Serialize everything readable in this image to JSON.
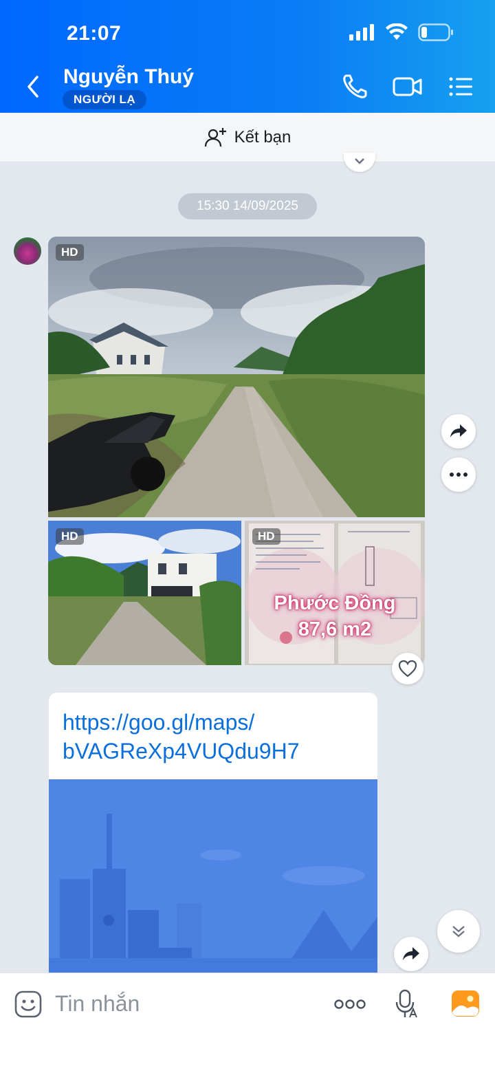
{
  "status": {
    "time": "21:07",
    "icons": [
      "signal-icon",
      "wifi-icon",
      "battery-icon"
    ]
  },
  "header": {
    "name": "Nguyễn Thuý",
    "badge": "NGƯỜI LẠ",
    "icons": [
      "back-icon",
      "phone-icon",
      "video-call-icon",
      "menu-list-icon"
    ]
  },
  "friend_bar": {
    "label": "Kết bạn"
  },
  "chat": {
    "timestamp": "15:30 14/09/2025",
    "photos": [
      {
        "badge": "HD"
      },
      {
        "badge": "HD"
      },
      {
        "badge": "HD",
        "overlay_line1": "Phước Đồng",
        "overlay_line2": "87,6 m2"
      }
    ],
    "link": {
      "url_line1": "https://goo.gl/maps/",
      "url_line2": "bVAGReXp4VUQdu9H7"
    }
  },
  "input": {
    "placeholder": "Tin nhắn",
    "icons": [
      "sticker-icon",
      "more-options-icon",
      "voice-to-text-icon",
      "gallery-icon"
    ]
  },
  "colors": {
    "header_blue": "#0068ff",
    "link_blue": "#0a6edc",
    "chat_bg": "#e3e8ee",
    "overlay_pink": "#d0306a"
  }
}
